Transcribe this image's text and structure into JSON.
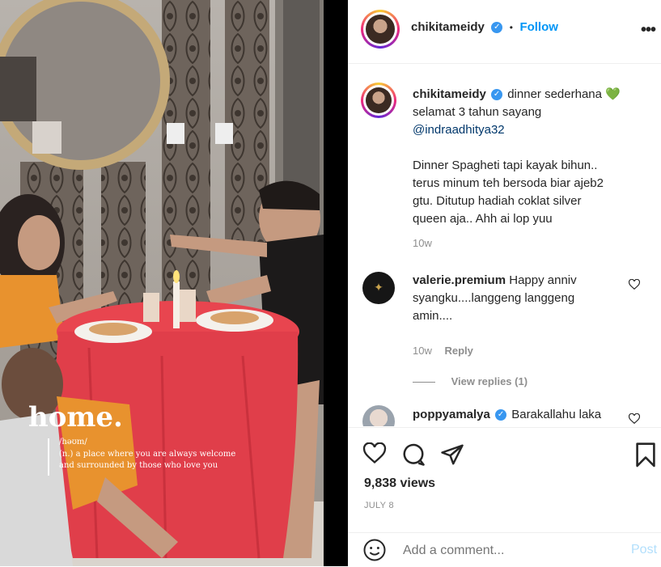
{
  "photo": {
    "overlay_title": "home.",
    "overlay_phonetic": "/həʊm/",
    "overlay_def_line1": "(n.) a place where you are always welcome",
    "overlay_def_line2": "and surrounded by those who love you"
  },
  "post_header": {
    "username": "chikitameidy",
    "separator": "•",
    "follow_label": "Follow",
    "more_icon": "more-horizontal-icon"
  },
  "caption": {
    "username": "chikitameidy",
    "text_line1": "dinner sederhana",
    "emoji": "💚",
    "text_line2": "selamat 3 tahun sayang",
    "mention": "@indraadhitya32",
    "body_line1": "Dinner Spagheti tapi kayak bihun..",
    "body_line2": "terus minum teh bersoda biar ajeb2",
    "body_line3": "gtu. Ditutup hadiah coklat silver",
    "body_line4": "queen aja.. Ahh ai lop yuu",
    "time": "10w"
  },
  "comments": [
    {
      "username": "valerie.premium",
      "line1": "Happy anniv",
      "line2": "syangku....langgeng langgeng",
      "line3": "amin....",
      "time": "10w",
      "reply_label": "Reply",
      "view_replies": "View replies (1)"
    },
    {
      "username": "poppyamalya",
      "line1": "Barakallahu laka"
    }
  ],
  "actions": {
    "views": "9,838 views",
    "date": "JULY 8"
  },
  "add_comment": {
    "placeholder": "Add a comment...",
    "post_label": "Post"
  },
  "colors": {
    "accent": "#0095f6",
    "verified": "#3897f0",
    "text": "#262626",
    "muted": "#8e8e8e",
    "tablecloth": "#e8454f"
  }
}
